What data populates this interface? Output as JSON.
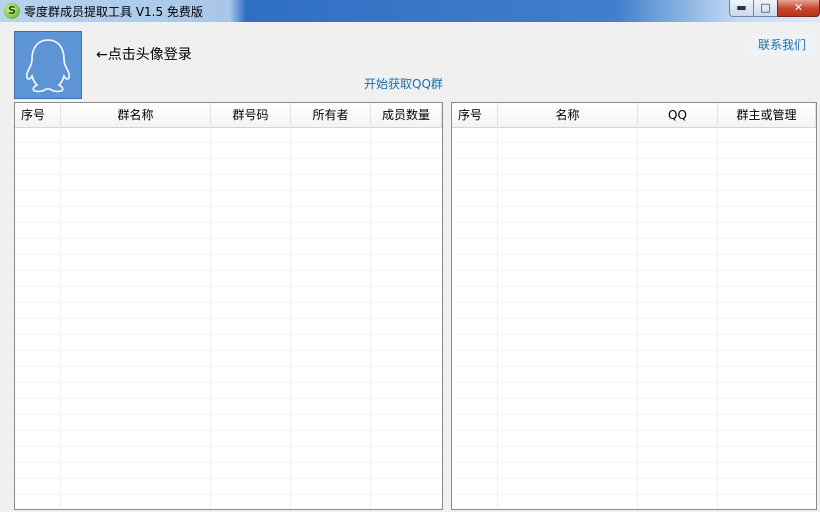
{
  "window": {
    "title": "零度群成员提取工具 V1.5 免费版",
    "icon_glyph": "S"
  },
  "header": {
    "login_hint": "←点击头像登录",
    "fetch_groups_label": "开始获取QQ群",
    "contact_label": "联系我们"
  },
  "groups_table": {
    "columns": [
      "序号",
      "群名称",
      "群号码",
      "所有者",
      "成员数量"
    ],
    "rows": []
  },
  "members_table": {
    "columns": [
      "序号",
      "名称",
      "QQ",
      "群主或管理"
    ],
    "rows": []
  },
  "colors": {
    "link": "#1d6fa8",
    "avatar_bg": "#5c94d6",
    "title_bar": "#3a78c8"
  }
}
